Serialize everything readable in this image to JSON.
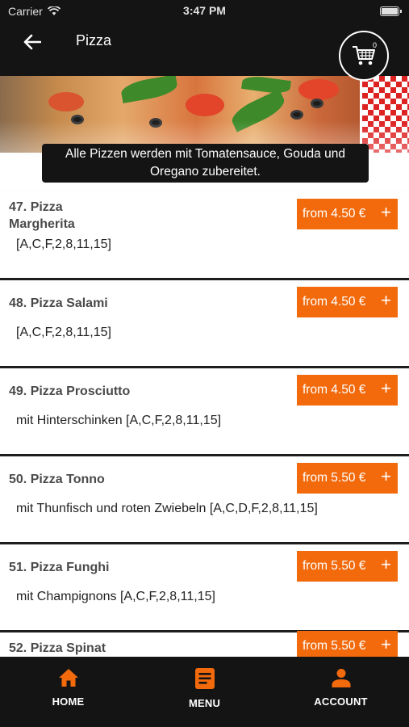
{
  "status_bar": {
    "carrier": "Carrier",
    "time": "3:47 PM"
  },
  "header": {
    "title": "Pizza",
    "cart_count": "0"
  },
  "info": {
    "line1": "Alle Pizzen werden mit Tomatensauce, Gouda und",
    "line2": "Oregano zubereitet."
  },
  "items": [
    {
      "name": "47. Pizza Margherita",
      "description": "[A,C,F,2,8,11,15]",
      "price_label": "from 4.50 €"
    },
    {
      "name": "48. Pizza Salami",
      "description": "[A,C,F,2,8,11,15]",
      "price_label": "from 4.50 €"
    },
    {
      "name": "49. Pizza Prosciutto",
      "description": "mit Hinterschinken [A,C,F,2,8,11,15]",
      "price_label": "from 4.50 €"
    },
    {
      "name": "50. Pizza Tonno",
      "description": "mit Thunfisch und roten Zwiebeln [A,C,D,F,2,8,11,15]",
      "price_label": "from 5.50 €"
    },
    {
      "name": "51. Pizza Funghi",
      "description": "mit Champignons [A,C,F,2,8,11,15]",
      "price_label": "from 5.50 €"
    },
    {
      "name": "52. Pizza Spinat",
      "description": "",
      "price_label": "from 5.50 €"
    }
  ],
  "add_symbol": "+",
  "nav": {
    "home": "HOME",
    "menu": "MENU",
    "account": "ACCOUNT"
  },
  "colors": {
    "accent": "#f26a0c",
    "bar": "#141414"
  }
}
